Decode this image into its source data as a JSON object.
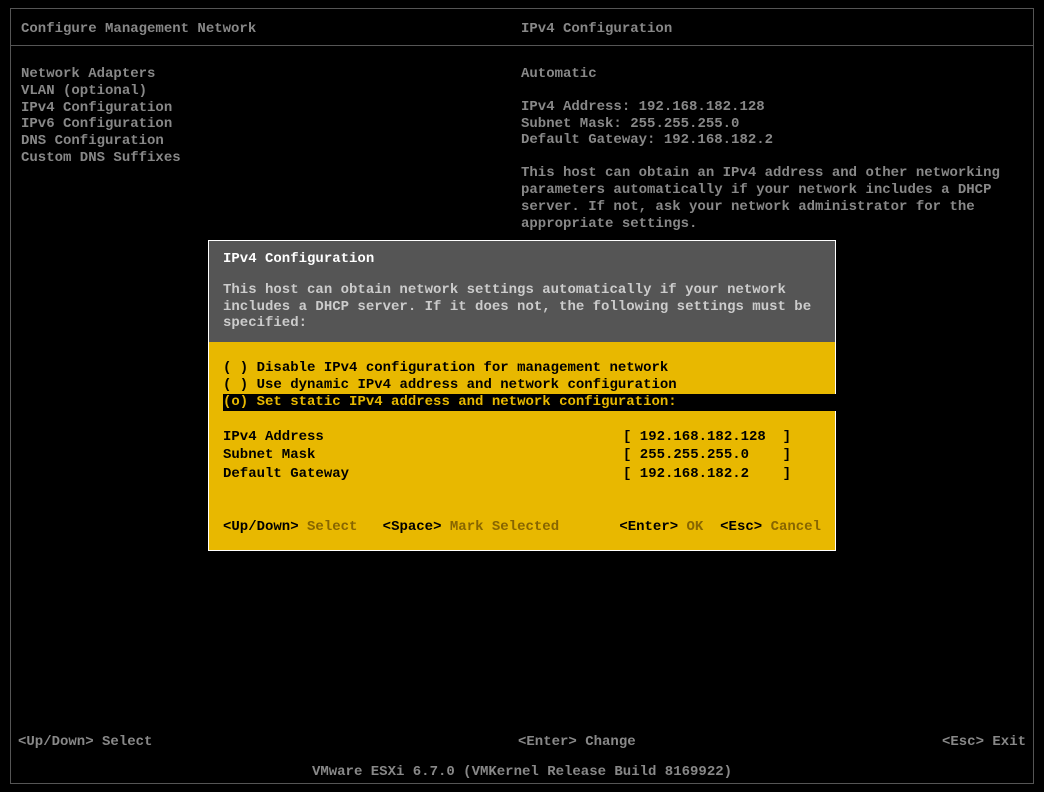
{
  "header": {
    "left": "Configure Management Network",
    "right": "IPv4 Configuration"
  },
  "sidebar": {
    "items": [
      "Network Adapters",
      "VLAN (optional)",
      "",
      "IPv4 Configuration",
      "IPv6 Configuration",
      "DNS Configuration",
      "Custom DNS Suffixes"
    ]
  },
  "info": {
    "mode": "Automatic",
    "address_label": "IPv4 Address:",
    "address_value": "192.168.182.128",
    "mask_label": "Subnet Mask:",
    "mask_value": "255.255.255.0",
    "gateway_label": "Default Gateway:",
    "gateway_value": "192.168.182.2",
    "description": "This host can obtain an IPv4 address and other networking parameters automatically if your network includes a DHCP server. If not, ask your network administrator for the appropriate settings."
  },
  "dialog": {
    "title": "IPv4 Configuration",
    "description": "This host can obtain network settings automatically if your network includes a DHCP server. If it does not, the following settings must be specified:",
    "options": [
      {
        "marker": "( )",
        "label": "Disable IPv4 configuration for management network",
        "selected": false
      },
      {
        "marker": "( )",
        "label": "Use dynamic IPv4 address and network configuration",
        "selected": false
      },
      {
        "marker": "(o)",
        "label": "Set static IPv4 address and network configuration:",
        "selected": true
      }
    ],
    "fields": [
      {
        "label": "IPv4 Address",
        "value": "[ 192.168.182.128  ]"
      },
      {
        "label": "Subnet Mask",
        "value": "[ 255.255.255.0    ]"
      },
      {
        "label": "Default Gateway",
        "value": "[ 192.168.182.2    ]"
      }
    ],
    "footer": {
      "updown_key": "<Up/Down>",
      "updown_label": "Select",
      "space_key": "<Space>",
      "space_label": "Mark Selected",
      "enter_key": "<Enter>",
      "enter_label": "OK",
      "esc_key": "<Esc>",
      "esc_label": "Cancel"
    }
  },
  "bottom": {
    "select_key": "<Up/Down>",
    "select_label": "Select",
    "change_key": "<Enter>",
    "change_label": "Change",
    "exit_key": "<Esc>",
    "exit_label": "Exit"
  },
  "version": "VMware ESXi 6.7.0 (VMKernel Release Build 8169922)"
}
